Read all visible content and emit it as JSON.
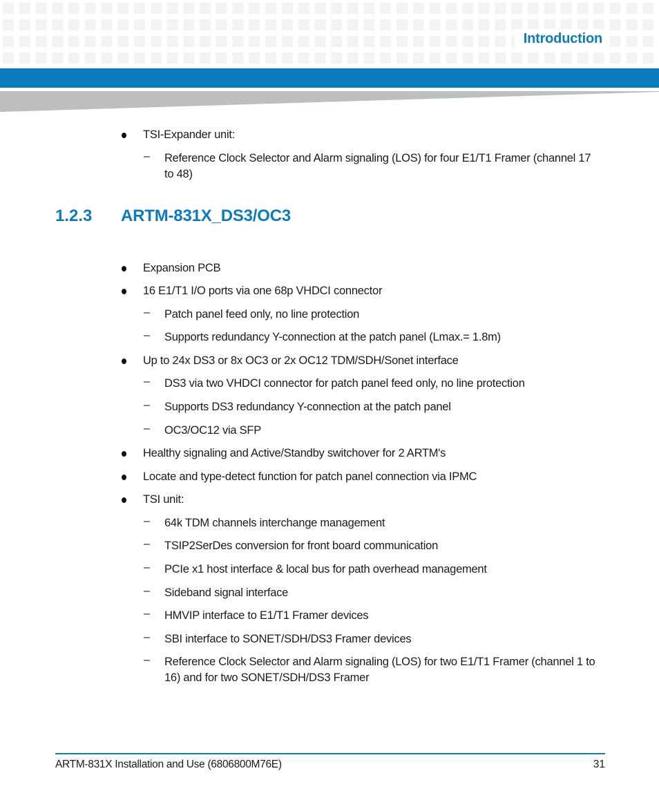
{
  "header": {
    "chapter_title": "Introduction"
  },
  "colors": {
    "accent": "#0a7bbd",
    "grid_cell": "#f3f3f3",
    "wedge": "#bdbebf",
    "text": "#1a1a1a"
  },
  "top_list": [
    {
      "level": 1,
      "text": "TSI-Expander unit:",
      "children": [
        {
          "level": 2,
          "text": "Reference Clock Selector and Alarm signaling (LOS) for four E1/T1 Framer (channel 17",
          "continuation": "to 48)"
        }
      ]
    }
  ],
  "section": {
    "number": "1.2.3",
    "title": "ARTM-831X_DS3/OC3"
  },
  "section_list": [
    {
      "level": 1,
      "text": "Expansion PCB"
    },
    {
      "level": 1,
      "text": "16 E1/T1 I/O ports via one 68p VHDCI connector"
    },
    {
      "level": 2,
      "text": "Patch panel feed only, no line protection"
    },
    {
      "level": 2,
      "text": "Supports redundancy Y-connection at the patch panel (Lmax.= 1.8m)"
    },
    {
      "level": 1,
      "text": "Up to 24x DS3 or 8x OC3 or 2x OC12 TDM/SDH/Sonet interface"
    },
    {
      "level": 2,
      "text": "DS3 via two VHDCI connector for patch panel feed only, no line protection"
    },
    {
      "level": 2,
      "text": "Supports DS3 redundancy Y-connection at the patch panel"
    },
    {
      "level": 2,
      "text": "OC3/OC12 via SFP"
    },
    {
      "level": 1,
      "text": "Healthy signaling and Active/Standby switchover for 2 ARTM's"
    },
    {
      "level": 1,
      "text": "Locate and type-detect function for patch panel connection via IPMC"
    },
    {
      "level": 1,
      "text": "TSI unit:"
    },
    {
      "level": 2,
      "text": "64k TDM channels interchange management"
    },
    {
      "level": 2,
      "text": "TSIP2SerDes conversion for front board communication"
    },
    {
      "level": 2,
      "text": "PCIe x1 host interface & local bus for path overhead management"
    },
    {
      "level": 2,
      "text": "Sideband signal interface"
    },
    {
      "level": 2,
      "text": "HMVIP interface to E1/T1 Framer devices"
    },
    {
      "level": 2,
      "text": "SBI interface to SONET/SDH/DS3 Framer devices"
    },
    {
      "level": 2,
      "text": "Reference Clock Selector and Alarm signaling (LOS) for two E1/T1 Framer (channel 1 to",
      "continuation": "16) and for two SONET/SDH/DS3 Framer"
    }
  ],
  "dash_glyph": "–",
  "footer": {
    "document": "ARTM-831X Installation and Use (6806800M76E)",
    "page_number": "31"
  }
}
